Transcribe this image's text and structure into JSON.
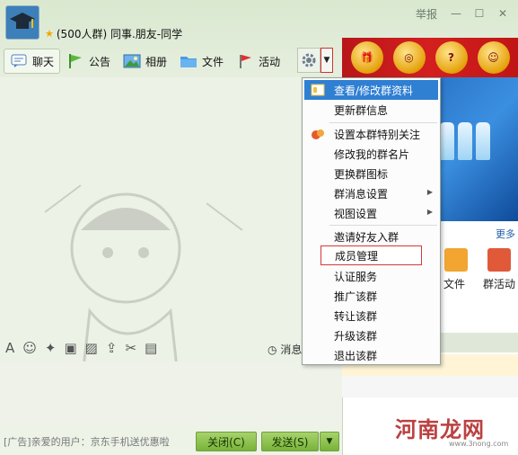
{
  "header": {
    "group_name": "(500人群) 同事.朋友-同学",
    "report_label": "举报",
    "controls": [
      "minimize",
      "maximize",
      "close"
    ]
  },
  "toolbar": {
    "items": [
      {
        "label": "聊天",
        "icon": "chat-icon"
      },
      {
        "label": "公告",
        "icon": "flag-icon"
      },
      {
        "label": "相册",
        "icon": "album-icon"
      },
      {
        "label": "文件",
        "icon": "folder-icon"
      },
      {
        "label": "活动",
        "icon": "event-flag-icon"
      }
    ],
    "settings_icon": "gear-icon",
    "dropdown_icon": "chevron-down-icon"
  },
  "menu": {
    "items": [
      {
        "label": "查看/修改群资料",
        "icon": "profile-card-icon",
        "active": true
      },
      {
        "label": "更新群信息"
      },
      {
        "label": "设置本群特别关注",
        "icon": "follow-icon"
      },
      {
        "label": "修改我的群名片"
      },
      {
        "label": "更换群图标"
      },
      {
        "label": "群消息设置",
        "submenu": true
      },
      {
        "label": "视图设置",
        "submenu": true
      },
      {
        "label": "邀请好友入群"
      },
      {
        "label": "成员管理",
        "boxed": true
      },
      {
        "label": "认证服务"
      },
      {
        "label": "推广该群"
      },
      {
        "label": "转让该群"
      },
      {
        "label": "升级该群"
      },
      {
        "label": "退出该群"
      }
    ]
  },
  "right_panel": {
    "more_label": "更多",
    "apps": [
      {
        "label": "文件"
      },
      {
        "label": "群活动"
      }
    ]
  },
  "input": {
    "message_record_label": "消息"
  },
  "footer": {
    "ad_text": "[广告]亲爱的用户：京东手机送优惠啦",
    "close_label": "关闭(C)",
    "send_label": "发送(S)"
  },
  "watermark": {
    "site_name": "河南龙网",
    "site_url": "www.3nong.com"
  },
  "colors": {
    "accent": "#2f7fd3",
    "send_button": "#8cc251",
    "highlight_border": "#d23a3a"
  }
}
